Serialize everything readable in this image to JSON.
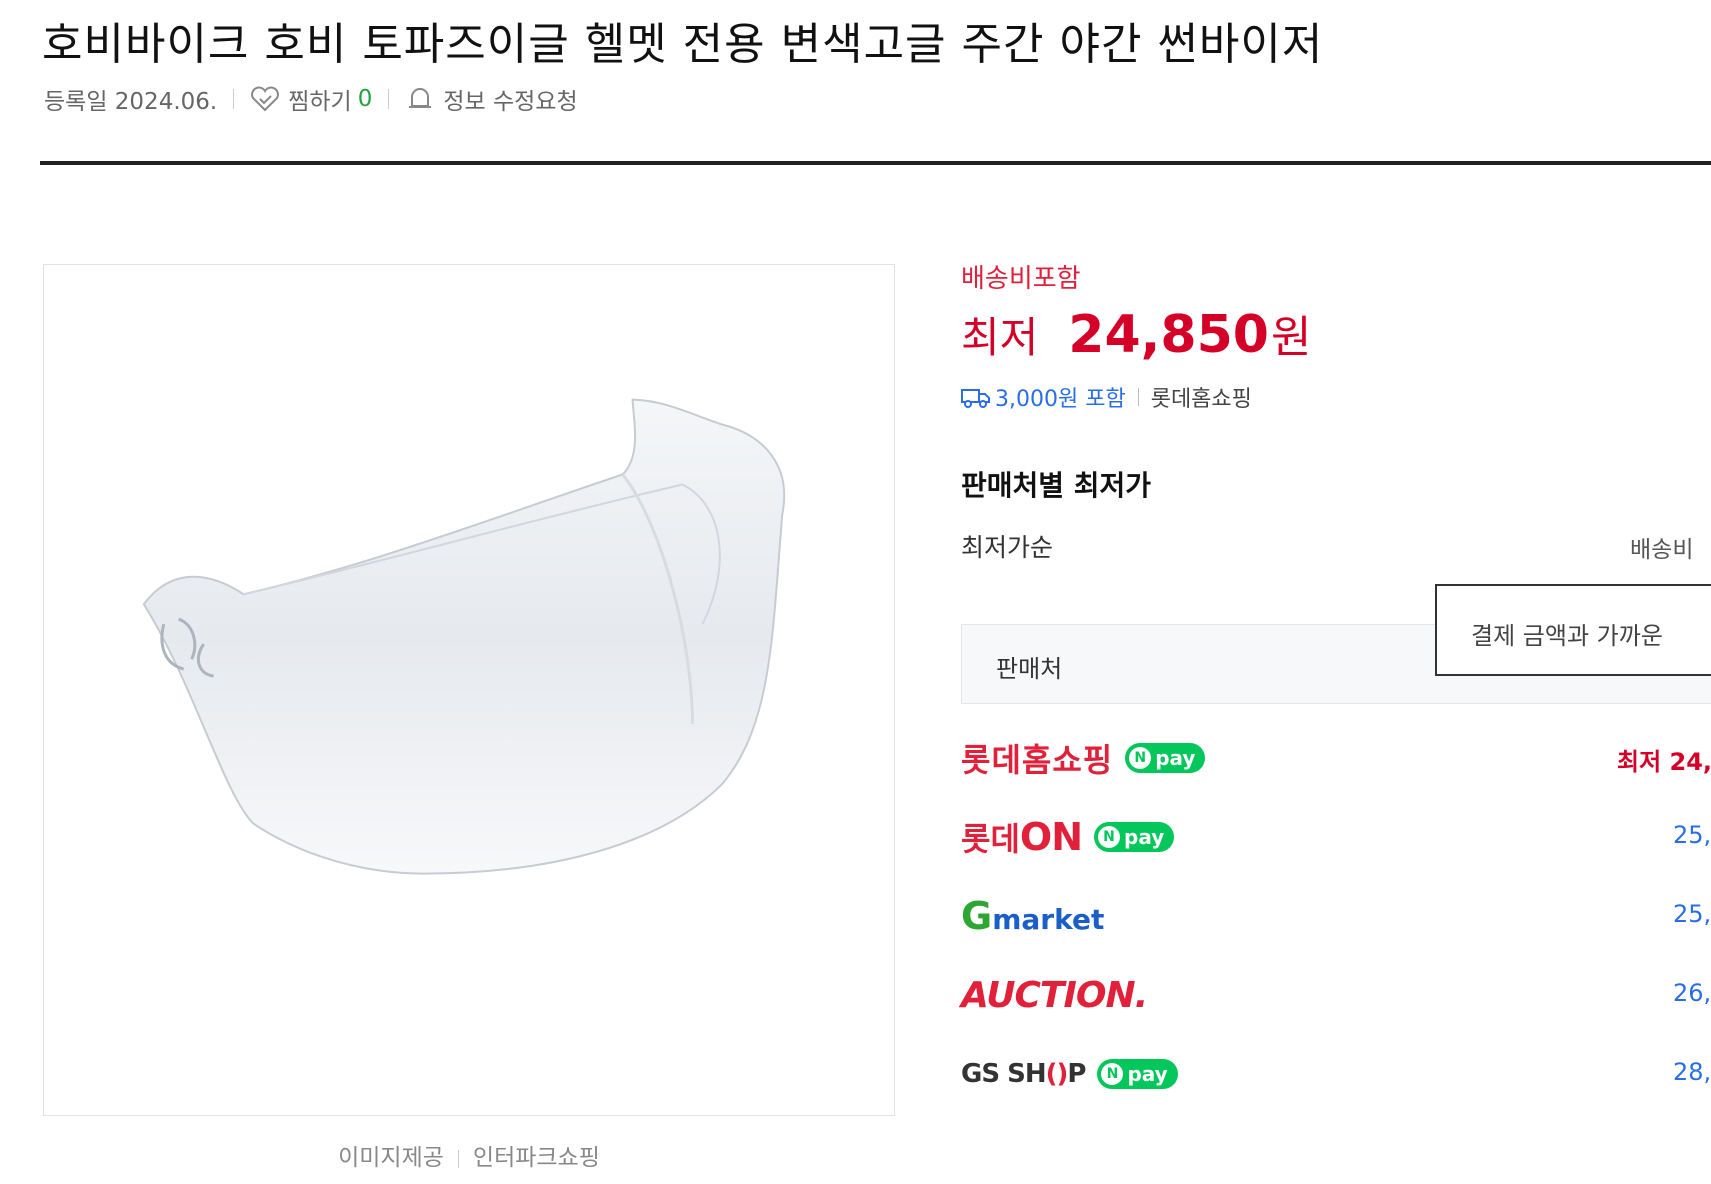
{
  "product": {
    "title": "호비바이크 호비 토파즈이글 헬멧 전용 변색고글 주간 야간 썬바이저",
    "registered": "등록일 2024.06.",
    "wishlist_label": "찜하기",
    "wishlist_count": "0",
    "report_label": "정보 수정요청"
  },
  "image": {
    "credit_label": "이미지제공",
    "credit_source": "인터파크쇼핑"
  },
  "price": {
    "shipping_included": "배송비포함",
    "lowest_label": "최저",
    "lowest_value": "24,850",
    "currency": "원",
    "shipping_fee": "3,000원 포함",
    "lowest_store": "롯데홈쇼핑"
  },
  "sellers": {
    "section_title": "판매처별 최저가",
    "sort_label": "최저가순",
    "sort_right": "배송비",
    "tooltip": "결제 금액과 가까운",
    "column_seller": "판매처",
    "npay_label": "pay",
    "npay_n": "N",
    "rows": [
      {
        "name": "롯데홈쇼핑",
        "price": "최저 24,",
        "npay": true
      },
      {
        "name_prefix": "롯데",
        "name_suffix": "ON",
        "price": "25,",
        "npay": true
      },
      {
        "name_prefix": "G",
        "name_suffix": "market",
        "price": "25,",
        "npay": false
      },
      {
        "name": "AUCTION.",
        "price": "26,",
        "npay": false
      },
      {
        "name_prefix": "GS SH",
        "name_mid": "()",
        "name_suffix": "P",
        "price": "28,",
        "npay": true
      }
    ]
  },
  "colors": {
    "accent_red": "#d40027",
    "link_blue": "#2a6de8",
    "npay_green": "#03c75a"
  }
}
